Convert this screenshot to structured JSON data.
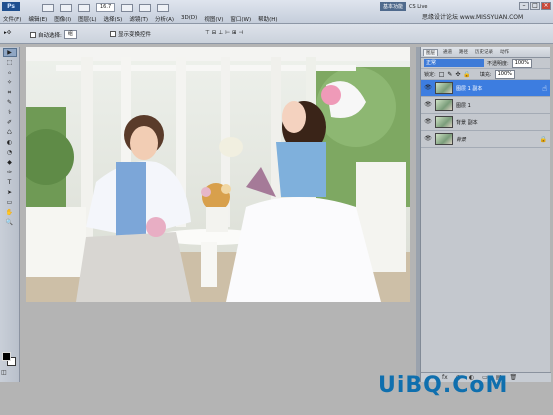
{
  "app": {
    "logo": "Ps"
  },
  "menu": [
    "文件(F)",
    "编辑(E)",
    "图像(I)",
    "图层(L)",
    "选择(S)",
    "滤镜(T)",
    "分析(A)",
    "3D(D)",
    "视图(V)",
    "窗口(W)",
    "帮助(H)"
  ],
  "appbar": {
    "zoom": "16.7",
    "workspace": "基本功能",
    "cs_live": "CS Live"
  },
  "watermark_top": "思缘设计论坛 www.MISSYUAN.COM",
  "options": {
    "auto_select_label": "自动选择:",
    "auto_select_value": "组",
    "show_transform_label": "显示变换控件"
  },
  "tools": [
    "▶",
    "⬚",
    "ℴ",
    "✧",
    "⌗",
    "✎",
    "⚕",
    "✐",
    "♺",
    "◐",
    "◔",
    "◆",
    "✑",
    "T",
    "➤",
    "▭",
    "✋",
    "🔍"
  ],
  "layers_panel": {
    "tabs": [
      "图层",
      "通道",
      "路径",
      "历史记录",
      "动作"
    ],
    "blend_mode": "正常",
    "opacity_label": "不透明度:",
    "opacity_value": "100%",
    "lock_label": "锁定:",
    "fill_label": "填充:",
    "fill_value": "100%",
    "layers": [
      {
        "name": "图层 1 副本",
        "selected": true
      },
      {
        "name": "图层 1",
        "selected": false
      },
      {
        "name": "背景 副本",
        "selected": false
      },
      {
        "name": "背景",
        "selected": false,
        "italic": true,
        "locked": true
      }
    ],
    "bottom_icons": [
      "∞",
      "fx",
      "◑",
      "◐",
      "▭",
      "▤",
      "🗑"
    ]
  },
  "watermark_bottom": "UiBQ.CoM",
  "colors": {
    "foreground": "#000000",
    "background": "#ffffff",
    "selection": "#3d7de0"
  }
}
